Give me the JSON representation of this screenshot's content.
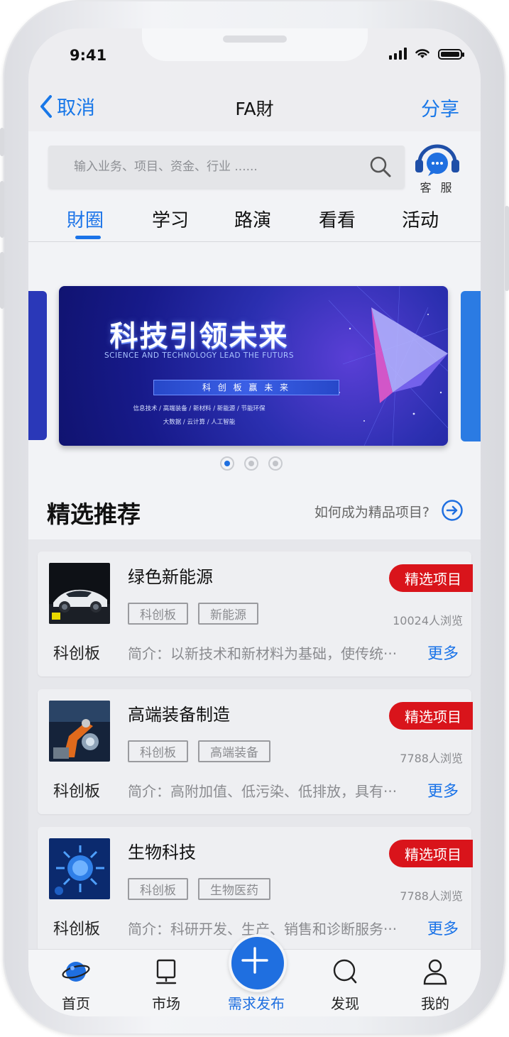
{
  "status": {
    "time": "9:41"
  },
  "navbar": {
    "cancel_label": "取消",
    "title": "FA財",
    "share_label": "分享"
  },
  "search": {
    "placeholder": "输入业务、项目、资金、行业 ......"
  },
  "service": {
    "label": "客 服"
  },
  "tabs": [
    {
      "label": "財圈",
      "active": true
    },
    {
      "label": "学习",
      "active": false
    },
    {
      "label": "路演",
      "active": false
    },
    {
      "label": "看看",
      "active": false
    },
    {
      "label": "活动",
      "active": false
    }
  ],
  "banner": {
    "title": "科技引领未来",
    "subtitle": "SCIENCE  AND  TECHNOLOGY  LEAD  THE FUTURS",
    "tag": "科 创 板      赢 未 来",
    "line1": "信息技术  /  高端装备  /  新材料  /  新能源  /  节能环保",
    "line2": "大数据  /  云计算  /  人工智能",
    "page_count": 3,
    "active_page": 1
  },
  "section": {
    "title": "精选推荐",
    "link": "如何成为精品项目?"
  },
  "cards": [
    {
      "title": "绿色新能源",
      "badge": "精选项目",
      "board": "科创板",
      "tags": [
        "科创板",
        "新能源"
      ],
      "views": "10024人浏览",
      "desc": "简介：以新技术和新材料为基础，使传统···",
      "more": "更多"
    },
    {
      "title": "高端装备制造",
      "badge": "精选项目",
      "board": "科创板",
      "tags": [
        "科创板",
        "高端装备"
      ],
      "views": "7788人浏览",
      "desc": "简介：高附加值、低污染、低排放，具有···",
      "more": "更多"
    },
    {
      "title": "生物科技",
      "badge": "精选项目",
      "board": "科创板",
      "tags": [
        "科创板",
        "生物医药"
      ],
      "views": "7788人浏览",
      "desc": "简介：科研开发、生产、销售和诊断服务···",
      "more": "更多"
    }
  ],
  "tabbar": [
    {
      "label": "首页"
    },
    {
      "label": "市场"
    },
    {
      "label": "需求发布"
    },
    {
      "label": "发现"
    },
    {
      "label": "我的"
    }
  ],
  "colors": {
    "accent": "#1B73E8",
    "badge": "#D9141B"
  }
}
